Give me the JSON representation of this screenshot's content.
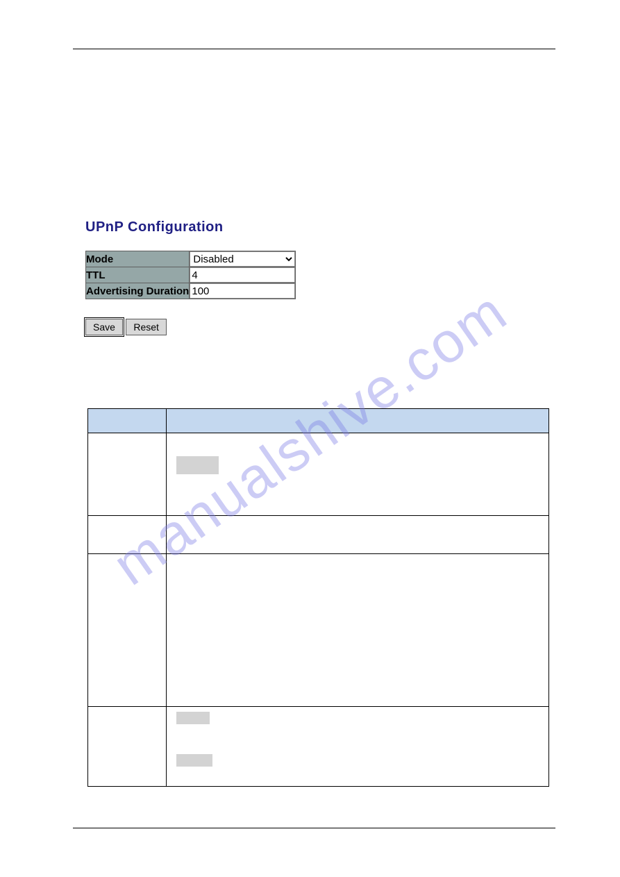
{
  "watermark": "manualshive.com",
  "upnp": {
    "title": "UPnP Configuration",
    "mode_label": "Mode",
    "mode_value": "Disabled",
    "ttl_label": "TTL",
    "ttl_value": "4",
    "adv_label": "Advertising Duration",
    "adv_value": "100",
    "save_label": "Save",
    "reset_label": "Reset"
  }
}
